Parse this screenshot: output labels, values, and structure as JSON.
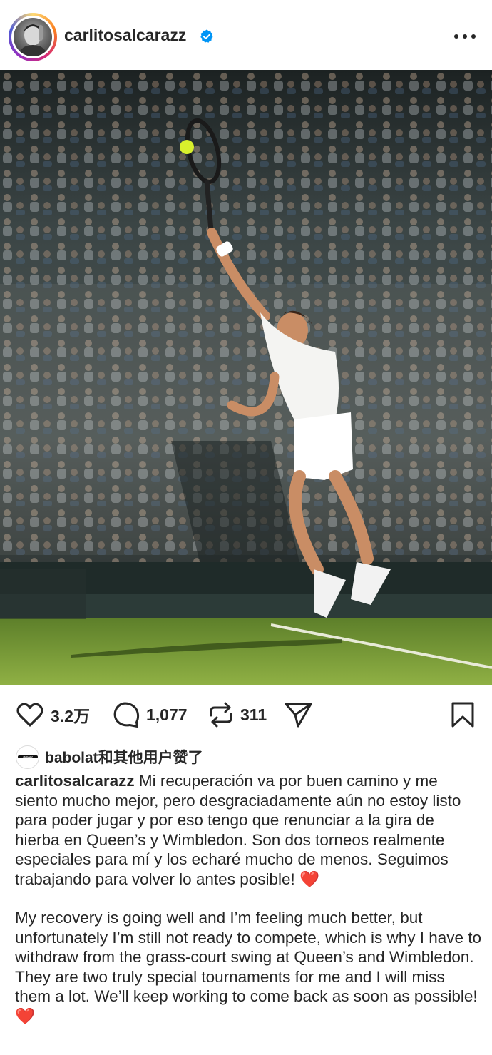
{
  "post": {
    "username": "carlitosalcarazz",
    "verified_icon": "verified-badge-icon",
    "more_icon": "more-options-icon"
  },
  "actions": {
    "likes_count": "3.2万",
    "comments_count": "1,077",
    "reposts_count": "311"
  },
  "liked_by": {
    "text": "babolat和其他用户赞了",
    "logo_text": "Babolat"
  },
  "caption": {
    "username": "carlitosalcarazz",
    "spanish": " Mi recuperación va por buen camino y me siento mucho mejor, pero desgraciadamente aún no estoy listo para poder jugar y por eso tengo que renunciar a la gira de hierba en Queen’s y Wimbledon. Son dos torneos realmente especiales para mí y los echaré mucho de menos. Seguimos trabajando para volver lo antes posible! ",
    "english": "My recovery is going well and I’m feeling much better, but unfortunately I’m still not ready to compete, which is why I have to withdraw from the grass-court swing at Queen’s and Wimbledon. They are two truly special tournaments for me and I will miss them a lot. We’ll keep working to come back as soon as possible! ",
    "emoji": "❤️"
  },
  "colors": {
    "verified_blue": "#0095f6",
    "heart_red": "#e0233a",
    "grass": "#7ea23c",
    "crowd_dark": "#2e3a3a"
  }
}
